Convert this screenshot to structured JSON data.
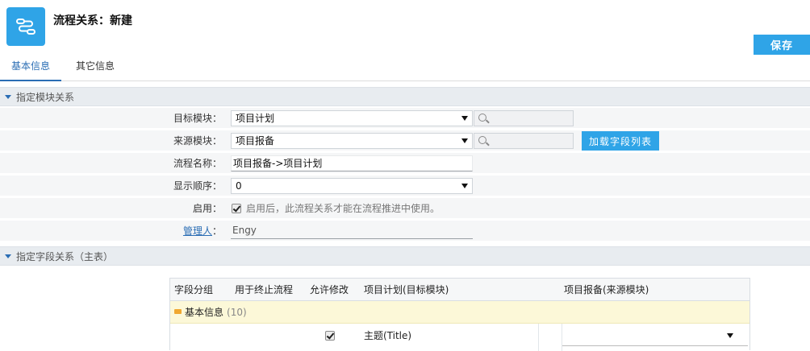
{
  "header": {
    "app_icon": "workflow-icon",
    "title": "流程关系：新建",
    "save_label": "保存"
  },
  "tabs": [
    {
      "label": "基本信息",
      "active": true
    },
    {
      "label": "其它信息",
      "active": false
    }
  ],
  "section_module": {
    "title": "指定模块关系",
    "target_module": {
      "label": "目标模块：",
      "value": "项目计划"
    },
    "source_module": {
      "label": "来源模块：",
      "value": "项目报备",
      "load_button": "加载字段列表"
    },
    "flow_name": {
      "label": "流程名称：",
      "value": "项目报备->项目计划"
    },
    "display_order": {
      "label": "显示顺序：",
      "value": "0"
    },
    "enabled": {
      "label": "启用：",
      "checked": true,
      "hint": "启用后，此流程关系才能在流程推进中使用。"
    },
    "manager": {
      "label_link": "管理人",
      "label_suffix": "：",
      "value": "Engy"
    }
  },
  "section_fields": {
    "title": "指定字段关系（主表）",
    "columns": [
      "字段分组",
      "用于终止流程",
      "允许修改",
      "项目计划(目标模块)",
      "项目报备(来源模块)"
    ],
    "groups": [
      {
        "name": "基本信息",
        "count": "(10)",
        "rows": [
          {
            "allow_edit": true,
            "target_field": "主题(Title)",
            "source_field": ""
          }
        ]
      }
    ]
  },
  "colors": {
    "accent": "#2fa4e7",
    "tab_active": "#2a6db4",
    "section_bg": "#e8ecf0",
    "group_bg": "#fcf8d8"
  }
}
